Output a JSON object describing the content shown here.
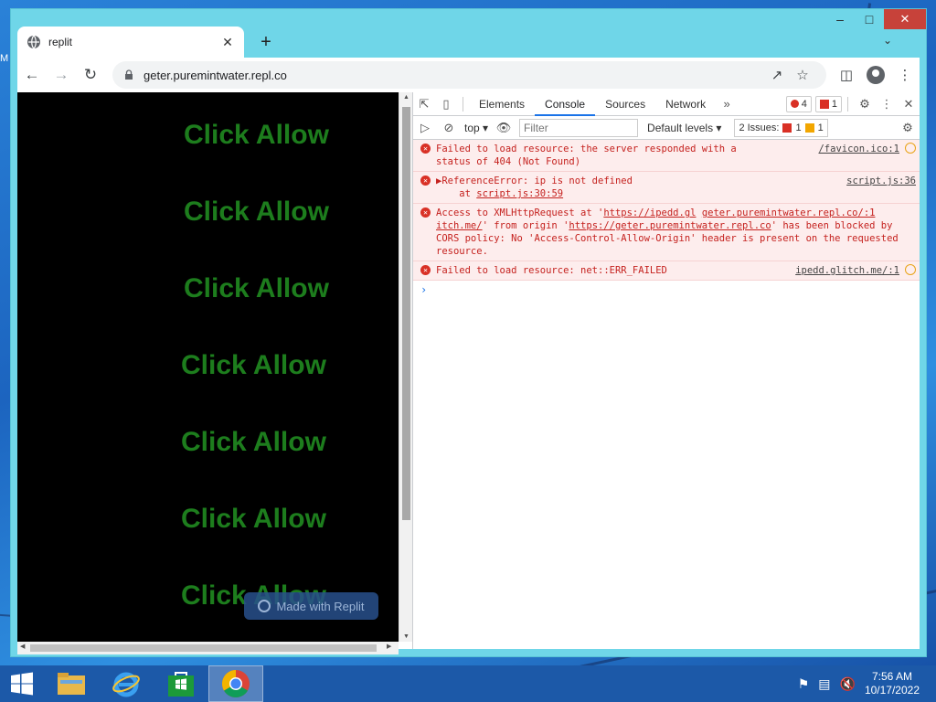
{
  "desktop": {
    "edge_text": "M"
  },
  "window": {
    "controls": {
      "minimize": "–",
      "maximize": "□",
      "close": "✕"
    }
  },
  "tab": {
    "title": "replit",
    "close": "✕"
  },
  "newtab": "+",
  "tabdrop": "⌄",
  "toolbar": {
    "url": "geter.puremintwater.repl.co"
  },
  "page": {
    "click_texts": [
      "Click Allow",
      "Click Allow",
      "Click Allow",
      "Click Allow",
      "Click Allow",
      "Click Allow",
      "Click Allow"
    ],
    "made_with": "Made with Replit"
  },
  "devtools": {
    "tabs": [
      "Elements",
      "Console",
      "Sources",
      "Network"
    ],
    "more": "»",
    "error_count": "4",
    "issue_count_top": "1",
    "context": "top",
    "filter_placeholder": "Filter",
    "levels": "Default levels",
    "issues_label": "2 Issues:",
    "issues_red": "1",
    "issues_yellow": "1",
    "messages": [
      {
        "line1": "Failed to load resource: the server responded with a",
        "line2": "status of 404 (Not Found)",
        "source": "/favicon.ico:1"
      },
      {
        "line1": "▶ReferenceError: ip is not defined",
        "line2_prefix": "    at ",
        "line2_link": "script.js:30:59",
        "source": "script.js:36"
      },
      {
        "a": "Access to XMLHttpRequest at '",
        "b": "https://ipedd.gl",
        "c": "itch.me/",
        "d": "' from origin '",
        "e": "https://geter.puremintwater.repl.co",
        "f": "' has been blocked by CORS policy: No 'Access-Control-Allow-Origin' header is present on the requested resource.",
        "source": "geter.puremintwater.repl.co/:1"
      },
      {
        "line1": "Failed to load resource: net::ERR_FAILED",
        "source": "ipedd.glitch.me/:1"
      }
    ],
    "prompt": "›"
  },
  "taskbar": {
    "time": "7:56 AM",
    "date": "10/17/2022"
  },
  "colors": {
    "accent_green": "#1d7d1d",
    "error_red": "#c5221f",
    "window_frame": "#6fd6e8",
    "taskbar": "#1c59a8"
  }
}
